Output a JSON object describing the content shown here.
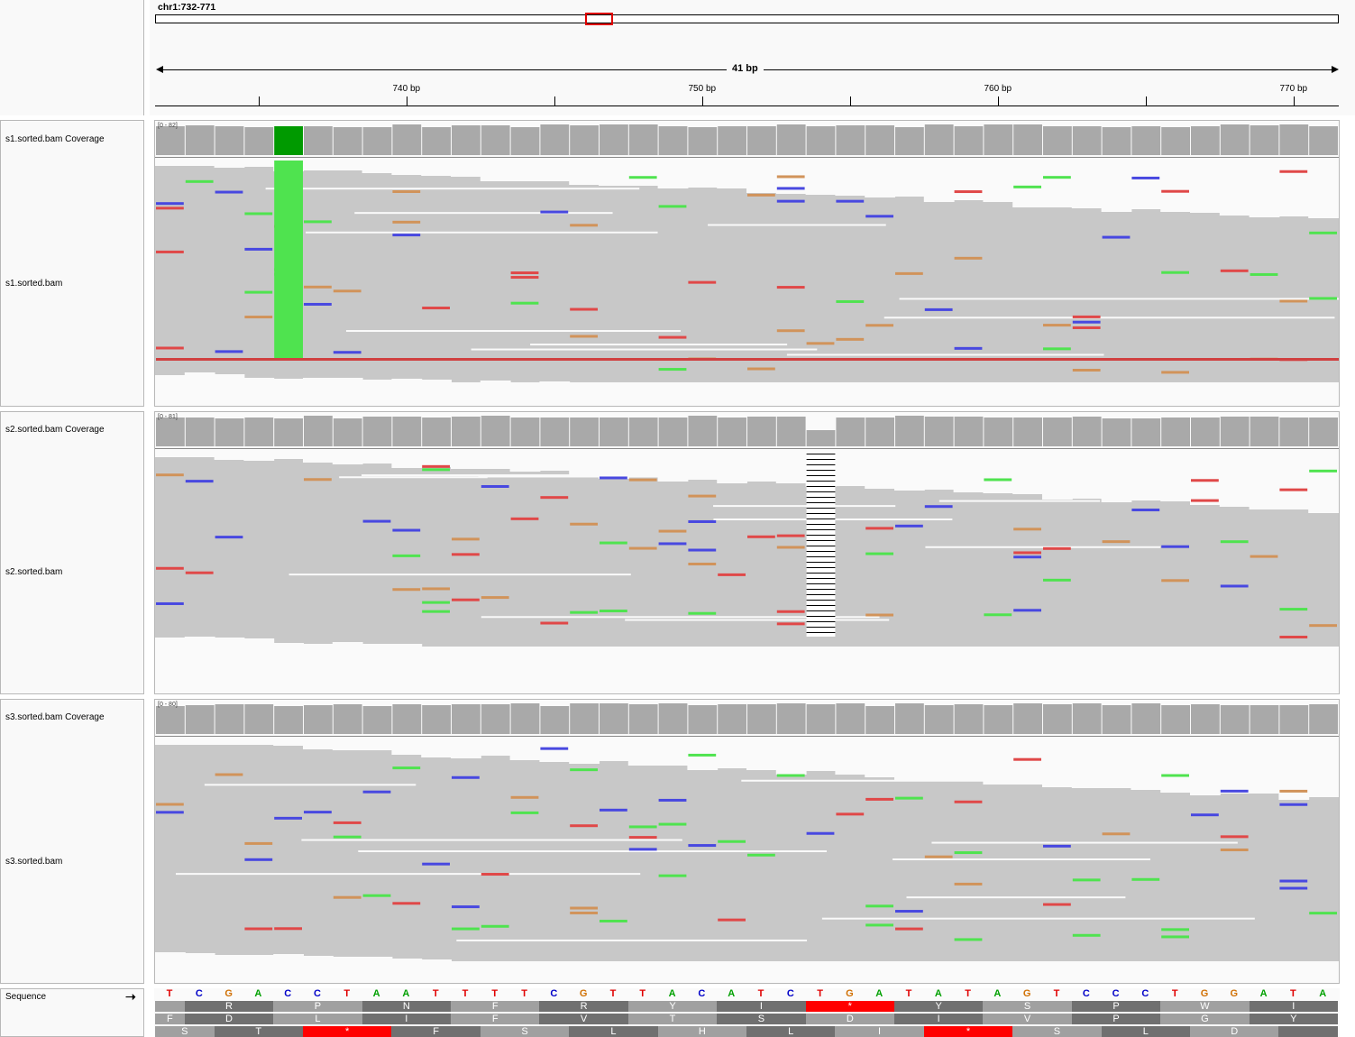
{
  "locus": "chr1:732-771",
  "span_label": "41 bp",
  "ruler_labels": [
    {
      "label": "740 bp",
      "bp": 740
    },
    {
      "label": "750 bp",
      "bp": 750
    },
    {
      "label": "760 bp",
      "bp": 760
    },
    {
      "label": "770 bp",
      "bp": 770
    }
  ],
  "tracks": [
    {
      "coverage_name": "s1.sorted.bam Coverage",
      "name": "s1.sorted.bam",
      "range": "[0 - 82]"
    },
    {
      "coverage_name": "s2.sorted.bam Coverage",
      "name": "s2.sorted.bam",
      "range": "[0 - 81]"
    },
    {
      "coverage_name": "s3.sorted.bam Coverage",
      "name": "s3.sorted.bam",
      "range": "[0 - 80]"
    }
  ],
  "sequence_label": "Sequence",
  "sequence_strand_icon": "right-arrow-icon",
  "sequence": "TCGACCTAATTTTCGTTACATCTGATATAGTCCCTGGATA",
  "base_colors": {
    "A": "#00a000",
    "C": "#0000c8",
    "G": "#d17105",
    "T": "#e00000"
  },
  "aa_frames": [
    [
      {
        "aa": "",
        "bases": 1
      },
      {
        "aa": "R",
        "bases": 3
      },
      {
        "aa": "P",
        "bases": 3
      },
      {
        "aa": "N",
        "bases": 3
      },
      {
        "aa": "F",
        "bases": 3
      },
      {
        "aa": "R",
        "bases": 3
      },
      {
        "aa": "Y",
        "bases": 3
      },
      {
        "aa": "I",
        "bases": 3
      },
      {
        "aa": "*",
        "bases": 3
      },
      {
        "aa": "Y",
        "bases": 3
      },
      {
        "aa": "S",
        "bases": 3
      },
      {
        "aa": "P",
        "bases": 3
      },
      {
        "aa": "W",
        "bases": 3
      },
      {
        "aa": "I",
        "bases": 3
      }
    ],
    [
      {
        "aa": "F",
        "bases": 1
      },
      {
        "aa": "D",
        "bases": 3
      },
      {
        "aa": "L",
        "bases": 3
      },
      {
        "aa": "I",
        "bases": 3
      },
      {
        "aa": "F",
        "bases": 3
      },
      {
        "aa": "V",
        "bases": 3
      },
      {
        "aa": "T",
        "bases": 3
      },
      {
        "aa": "S",
        "bases": 3
      },
      {
        "aa": "D",
        "bases": 3
      },
      {
        "aa": "I",
        "bases": 3
      },
      {
        "aa": "V",
        "bases": 3
      },
      {
        "aa": "P",
        "bases": 3
      },
      {
        "aa": "G",
        "bases": 3
      },
      {
        "aa": "Y",
        "bases": 3
      }
    ],
    [
      {
        "aa": "S",
        "bases": 2
      },
      {
        "aa": "T",
        "bases": 3
      },
      {
        "aa": "*",
        "bases": 3
      },
      {
        "aa": "F",
        "bases": 3
      },
      {
        "aa": "S",
        "bases": 3
      },
      {
        "aa": "L",
        "bases": 3
      },
      {
        "aa": "H",
        "bases": 3
      },
      {
        "aa": "L",
        "bases": 3
      },
      {
        "aa": "I",
        "bases": 3
      },
      {
        "aa": "*",
        "bases": 3
      },
      {
        "aa": "S",
        "bases": 3
      },
      {
        "aa": "L",
        "bases": 3
      },
      {
        "aa": "D",
        "bases": 3
      },
      {
        "aa": "",
        "bases": 2
      }
    ]
  ],
  "colors": {
    "read": "#c8c8c8",
    "coverage": "#a9a9a9",
    "mismatch_A": "#4fe34f",
    "mismatch_C": "#4848e0",
    "mismatch_G": "#d1935a",
    "mismatch_T": "#e04848",
    "stop_codon": "#ff0000",
    "viewbox": "#e00000",
    "coverage_variant": "#009a00"
  }
}
